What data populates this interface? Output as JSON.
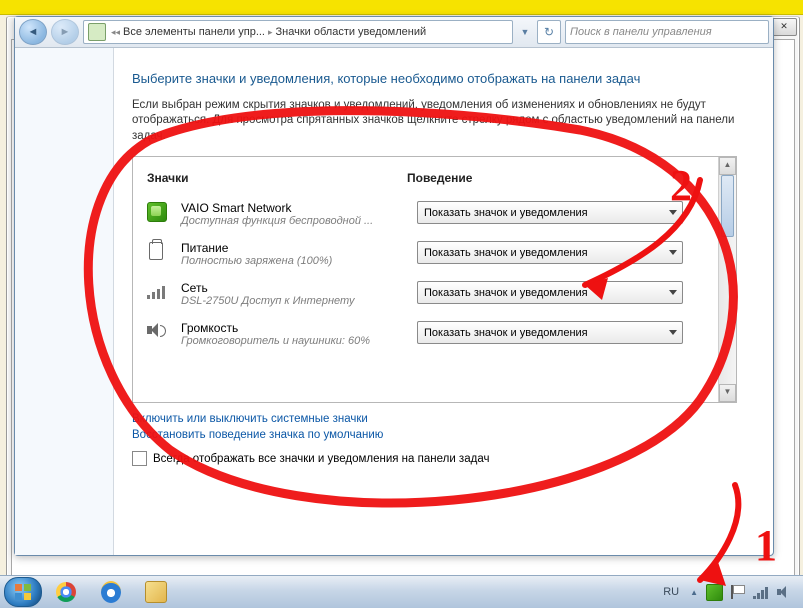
{
  "breadcrumb": {
    "root_label": "Все элементы панели упр...",
    "current_label": "Значки области уведомлений"
  },
  "search": {
    "placeholder": "Поиск в панели управления"
  },
  "page": {
    "heading": "Выберите значки и уведомления, которые необходимо отображать на панели задач",
    "description": "Если выбран режим скрытия значков и уведомлений, уведомления об изменениях и обновлениях не будут отображаться. Для просмотра спрятанных значков щелкните стрелку рядом с областью уведомлений на панели задач."
  },
  "columns": {
    "icons": "Значки",
    "behavior": "Поведение"
  },
  "dropdown_value": "Показать значок и уведомления",
  "rows": [
    {
      "title": "VAIO Smart Network",
      "sub": "Доступная функция беспроводной ..."
    },
    {
      "title": "Питание",
      "sub": "Полностью заряжена (100%)"
    },
    {
      "title": "Сеть",
      "sub": "DSL-2750U Доступ к Интернету"
    },
    {
      "title": "Громкость",
      "sub": "Громкоговоритель и наушники: 60%"
    }
  ],
  "links": {
    "toggle_system": "Включить или выключить системные значки",
    "restore_default": "Восстановить поведение значка по умолчанию"
  },
  "checkbox_label": "Всегда отображать все значки и уведомления на панели задач",
  "tray": {
    "lang": "RU"
  },
  "annotations": {
    "n1": "1",
    "n2": "2"
  }
}
